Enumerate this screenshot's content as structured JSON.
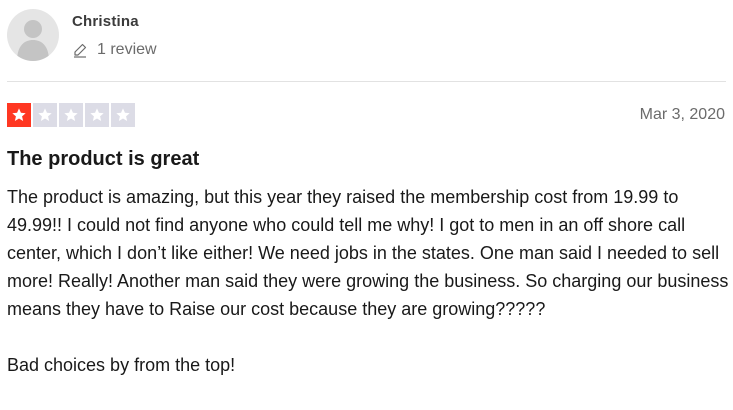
{
  "reviewer": {
    "name": "Christina",
    "review_count": "1 review",
    "avatar_icon": "user-silhouette-icon",
    "count_icon": "pencil-icon"
  },
  "review": {
    "rating": 1,
    "rating_max": 5,
    "date": "Mar 3, 2020",
    "title": "The product is great",
    "paragraphs": [
      "The product is amazing, but this year they raised the membership cost from 19.99 to 49.99!! I could not find anyone who could tell me why! I got to men in an off shore call center, which I don’t like either! We need jobs in the states. One man said I needed to sell more! Really! Another man said they were growing the business. So charging our business means they have to Raise our cost because they are growing?????",
      "Bad choices by from the top!"
    ]
  },
  "colors": {
    "star_filled": "#ff3722",
    "star_empty": "#dcdce6",
    "text_primary": "#191919",
    "text_secondary": "#6b6b6b"
  }
}
